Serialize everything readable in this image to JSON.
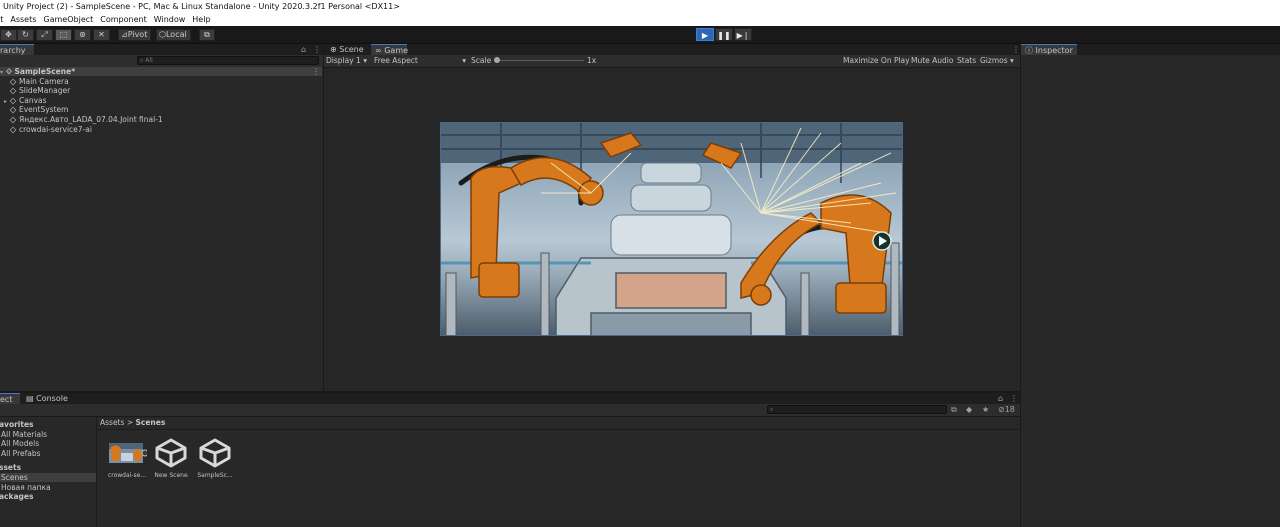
{
  "window": {
    "title": "Unity Project (2) - SampleScene - PC, Mac & Linux Standalone - Unity 2020.3.2f1 Personal <DX11>"
  },
  "menu": [
    "it",
    "Assets",
    "GameObject",
    "Component",
    "Window",
    "Help"
  ],
  "toolbar": {
    "pivot_label": "Pivot",
    "local_label": "Local"
  },
  "hierarchy": {
    "tab_label": "rarchy",
    "search_placeholder": "All",
    "scene_name": "SampleScene*",
    "items": [
      {
        "label": "Main Camera",
        "expandable": false
      },
      {
        "label": "SlideManager",
        "expandable": false
      },
      {
        "label": "Canvas",
        "expandable": true
      },
      {
        "label": "EventSystem",
        "expandable": false
      },
      {
        "label": "Яндекс.Авто_LADA_07.04.Joint final-1",
        "expandable": false
      },
      {
        "label": "crowdai-service7-ai",
        "expandable": false
      }
    ]
  },
  "center": {
    "tabs": [
      "Scene",
      "Game"
    ],
    "active_tab": "Game",
    "display_label": "Display 1",
    "aspect_label": "Free Aspect",
    "scale_label": "Scale",
    "scale_value": "1x",
    "buttons": [
      "Maximize On Play",
      "Mute Audio",
      "Stats",
      "Gizmos"
    ]
  },
  "inspector": {
    "tab_label": "Inspector"
  },
  "project": {
    "tabs": [
      "ect",
      "Console"
    ],
    "breadcrumb_root": "Assets",
    "breadcrumb_separator": ">",
    "breadcrumb_current": "Scenes",
    "hidden_count": "18",
    "tree": [
      {
        "label": "avorites",
        "bold": true
      },
      {
        "label": "All Materials",
        "bold": false
      },
      {
        "label": "All Models",
        "bold": false
      },
      {
        "label": "All Prefabs",
        "bold": false
      },
      {
        "label": "ssets",
        "bold": true
      },
      {
        "label": "Scenes",
        "bold": false,
        "selected": true
      },
      {
        "label": "Новая папка",
        "bold": false
      },
      {
        "label": "ackages",
        "bold": true
      }
    ],
    "assets": [
      {
        "label": "crowdai-se...",
        "kind": "image"
      },
      {
        "label": "New Scene",
        "kind": "unity"
      },
      {
        "label": "SampleSc...",
        "kind": "unity"
      }
    ]
  },
  "colors": {
    "play_active": "#2e66b6",
    "panel": "#282828",
    "tab_highlight": "#3c7cd0",
    "robot_orange": "#d8781c"
  }
}
